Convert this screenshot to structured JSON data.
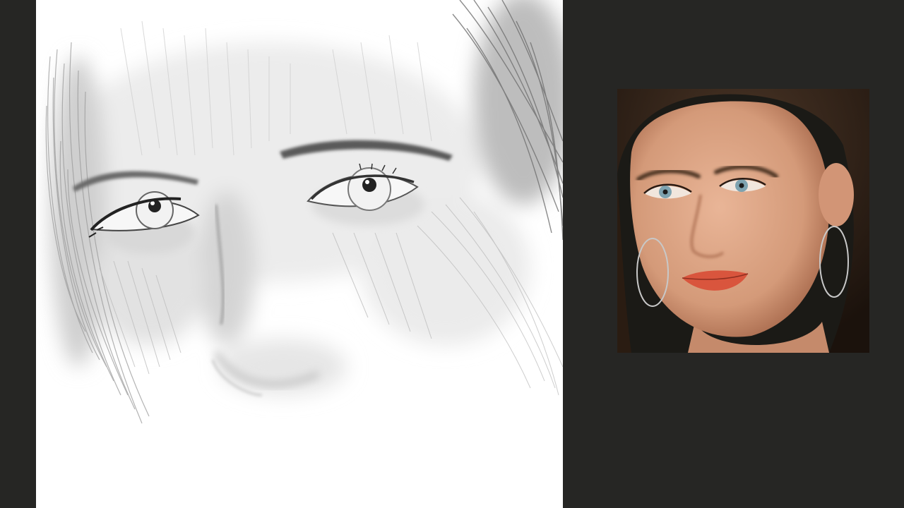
{
  "app": {
    "background_color": "#262624",
    "canvas_color": "#ffffff"
  },
  "canvas": {
    "subject": "pencil-sketch-of-eyes-and-nose"
  },
  "reference": {
    "subject": "reference-portrait-photo",
    "colors": {
      "background": "#1b1a16",
      "hair": "#3a2a1e",
      "skin": "#d9a384",
      "lips": "#d9553d",
      "iris": "#7ea3b0",
      "earring": "#c8c8c8"
    }
  }
}
